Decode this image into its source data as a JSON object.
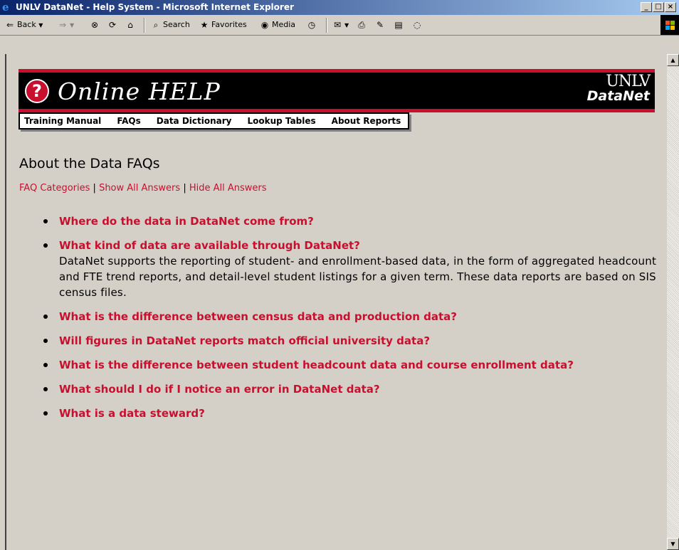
{
  "window": {
    "title": "UNLV DataNet - Help System - Microsoft Internet Explorer"
  },
  "toolbar": {
    "back": "Back",
    "search": "Search",
    "favorites": "Favorites",
    "media": "Media"
  },
  "banner": {
    "brand": "Online HELP",
    "unlv_top": "UNLV",
    "unlv_bottom": "DataNet"
  },
  "nav": {
    "items": [
      {
        "label": "Training Manual"
      },
      {
        "label": "FAQs"
      },
      {
        "label": "Data Dictionary"
      },
      {
        "label": "Lookup Tables"
      },
      {
        "label": "About Reports"
      }
    ]
  },
  "page": {
    "heading": "About the Data FAQs",
    "links": {
      "categories": "FAQ Categories",
      "show_all": "Show All Answers",
      "hide_all": "Hide All Answers",
      "separator": "|"
    },
    "faqs": [
      {
        "question": "Where do the data in DataNet come from?",
        "answer": ""
      },
      {
        "question": "What kind of data are available through DataNet?",
        "answer": "DataNet supports the reporting of student- and enrollment-based data, in the form of aggregated headcount and FTE trend reports, and detail-level student listings for a given term. These data reports are based on SIS census files."
      },
      {
        "question": "What is the difference between census data and production data?",
        "answer": ""
      },
      {
        "question": "Will figures in DataNet reports match official university data?",
        "answer": ""
      },
      {
        "question": "What is the difference between student headcount data and course enrollment data?",
        "answer": ""
      },
      {
        "question": "What should I do if I notice an error in DataNet data?",
        "answer": ""
      },
      {
        "question": "What is a data steward?",
        "answer": ""
      }
    ]
  },
  "colors": {
    "accent_red": "#c8102e",
    "banner_black": "#000000",
    "page_bg": "#d4d0c8",
    "title_blue": "#0a246a"
  }
}
